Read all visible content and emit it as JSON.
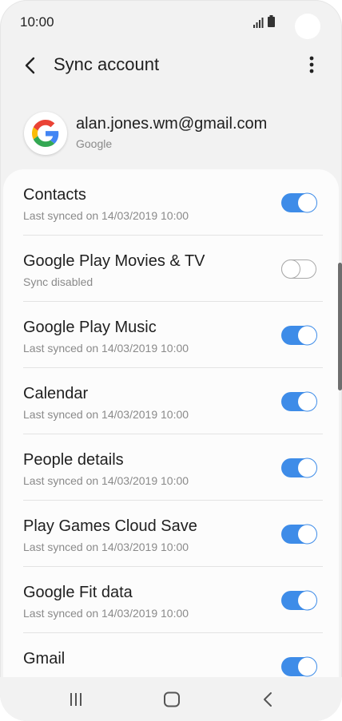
{
  "status_bar": {
    "time": "10:00"
  },
  "app_bar": {
    "title": "Sync account"
  },
  "account": {
    "email": "alan.jones.wm@gmail.com",
    "provider": "Google"
  },
  "sync_items": [
    {
      "title": "Contacts",
      "status": "Last synced on 14/03/2019  10:00",
      "enabled": true
    },
    {
      "title": "Google Play Movies & TV",
      "status": "Sync disabled",
      "enabled": false
    },
    {
      "title": "Google Play Music",
      "status": "Last synced on 14/03/2019  10:00",
      "enabled": true
    },
    {
      "title": "Calendar",
      "status": "Last synced on 14/03/2019  10:00",
      "enabled": true
    },
    {
      "title": "People details",
      "status": "Last synced on 14/03/2019  10:00",
      "enabled": true
    },
    {
      "title": "Play Games Cloud Save",
      "status": "Last synced on 14/03/2019  10:00",
      "enabled": true
    },
    {
      "title": "Google Fit data",
      "status": "Last synced on 14/03/2019  10:00",
      "enabled": true
    },
    {
      "title": "Gmail",
      "status": "",
      "enabled": true
    }
  ],
  "colors": {
    "accent": "#3e8ce8",
    "background": "#f2f2f2",
    "card": "#fcfcfc"
  },
  "icons": {
    "back": "chevron-left-icon",
    "more": "more-vertical-icon",
    "logo": "google-logo-icon",
    "nav_recents": "recents-icon",
    "nav_home": "home-icon",
    "nav_back": "back-icon"
  }
}
